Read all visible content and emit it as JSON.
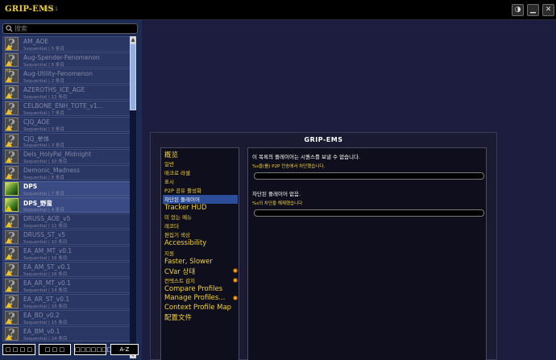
{
  "app": {
    "title": "GRIP-EMS",
    "version": "v2.0.1"
  },
  "window_buttons": [
    {
      "name": "snapshot-icon",
      "glyph": "◑"
    },
    {
      "name": "minimize-icon",
      "glyph": "▁"
    },
    {
      "name": "close-icon",
      "glyph": "✕"
    }
  ],
  "search": {
    "placeholder": "搜索",
    "value": ""
  },
  "sequences": [
    {
      "name": "AM_AOE",
      "sub": "Sequential | 5 条目",
      "icon": "q",
      "warn": true
    },
    {
      "name": "Aug-Spender-Fenomenon",
      "sub": "Sequential | 8 条目",
      "icon": "q",
      "warn": true
    },
    {
      "name": "Aug-Utility-Fenomenon",
      "sub": "Sequential | 2 条目",
      "icon": "q",
      "warn": true,
      "badge": "53"
    },
    {
      "name": "AZEROTHS_ICE_AGE",
      "sub": "Sequential | 12 条目",
      "icon": "q",
      "warn": true
    },
    {
      "name": "CELBONE_ENH_TOTE_v1...",
      "sub": "Sequential | 7 条目",
      "icon": "q",
      "warn": true
    },
    {
      "name": "CJQ_AOE",
      "sub": "Sequential | 3 条目",
      "icon": "q",
      "warn": true
    },
    {
      "name": "CJQ_单体",
      "sub": "Sequential | 3 条目",
      "icon": "q",
      "warn": true
    },
    {
      "name": "Dels_HolyPal_Midnight",
      "sub": "Sequential | 10 条目",
      "icon": "q",
      "warn": true
    },
    {
      "name": "Demonic_Madness",
      "sub": "Sequential | 8 条目",
      "icon": "q",
      "warn": true
    },
    {
      "name": "DPS",
      "sub": "Sequential | 7 条目",
      "icon": "dps",
      "warn": false,
      "active": true
    },
    {
      "name": "DPS_野蛮",
      "sub": "Sequential | 4 条目",
      "icon": "dps",
      "warn": true,
      "active": true
    },
    {
      "name": "DRUSS_AOE_v5",
      "sub": "Sequential | 11 条目",
      "icon": "q",
      "warn": true
    },
    {
      "name": "DRUSS_ST_v5",
      "sub": "Sequential | 10 条目",
      "icon": "q",
      "warn": true
    },
    {
      "name": "EA_AM_MT_v0.1",
      "sub": "Sequential | 16 条目",
      "icon": "q",
      "warn": true
    },
    {
      "name": "EA_AM_ST_v0.1",
      "sub": "Sequential | 16 条目",
      "icon": "q",
      "warn": true
    },
    {
      "name": "EA_AR_MT_v0.1",
      "sub": "Sequential | 14 条目",
      "icon": "q",
      "warn": true
    },
    {
      "name": "EA_AR_ST_v0.1",
      "sub": "Sequential | 16 条目",
      "icon": "q",
      "warn": true
    },
    {
      "name": "EA_BD_v0.2",
      "sub": "Sequential | 15 条目",
      "icon": "q",
      "warn": true
    },
    {
      "name": "EA_BM_v0.1",
      "sub": "Sequential | 24 条目",
      "icon": "q",
      "warn": true
    }
  ],
  "bottom_buttons": [
    "□ □ □ □",
    "□ □ □",
    "□□□□□□□",
    "A-Z"
  ],
  "dialog": {
    "title": "GRIP-EMS",
    "nav": [
      {
        "label": "概览",
        "big": true
      },
      {
        "label": "일반"
      },
      {
        "label": "매크로 라셀"
      },
      {
        "label": "표시"
      },
      {
        "label": "P2P 공유 활성화"
      },
      {
        "label": "차단된 플레이어",
        "selected": true
      },
      {
        "label": "Tracker HUD",
        "big": true
      },
      {
        "label": "미 었는 메뉴"
      },
      {
        "label": "레코더"
      },
      {
        "label": "편집기 색상"
      },
      {
        "label": "Accessibility",
        "big": true
      },
      {
        "label": "지원"
      },
      {
        "label": "Faster, Slower",
        "big": true
      },
      {
        "label": "CVar 상태",
        "big": true,
        "dot": true
      },
      {
        "label": "컨텍스트 감지",
        "dot": true
      },
      {
        "label": "Compare Profiles",
        "big": true
      },
      {
        "label": "Manage Profiles...",
        "big": true,
        "dot": true
      },
      {
        "label": "Context Profile Map",
        "big": true
      },
      {
        "label": "配置文件",
        "big": true
      }
    ],
    "content": {
      "heading1": "이 목록의 플레이어는 시퀀스를 보낼 수 없습니다.",
      "hint1": "%s을(를) P2P 전송에서 차단했습니다.",
      "field1": "",
      "heading2": "차단된 플레이어 없음.",
      "hint2": "%s의 차단을 해제했습니다",
      "field2": ""
    }
  }
}
